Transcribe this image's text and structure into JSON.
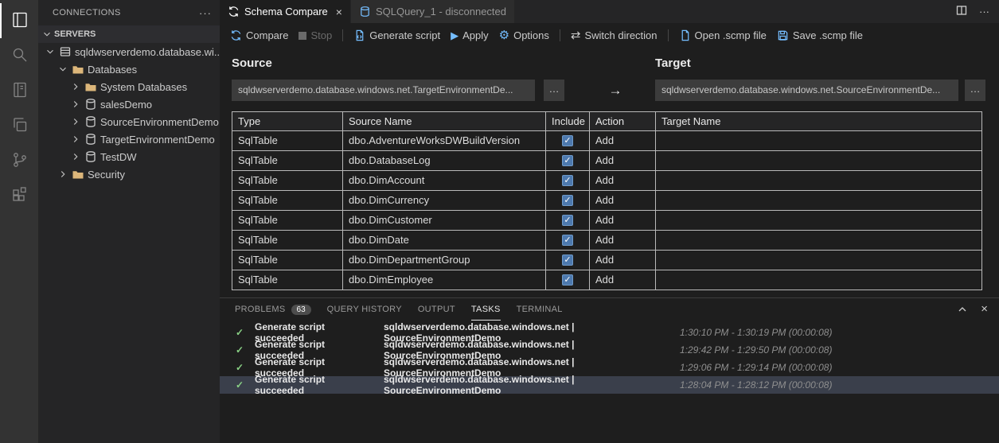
{
  "glyphs": {
    "more": "···",
    "ellipsis": "…",
    "arrow_right": "→",
    "close": "×",
    "check": "✓",
    "play": "▶",
    "gear": "⚙",
    "switch": "⇄"
  },
  "activity_bar": {
    "icons": [
      "connections-icon",
      "search-icon",
      "notebooks-icon",
      "copy-icon",
      "source-control-icon",
      "extensions-icon"
    ]
  },
  "sidebar": {
    "title": "CONNECTIONS",
    "section": "SERVERS",
    "tree": [
      {
        "label": "sqldwserverdemo.database.wi...",
        "icon": "server",
        "expanded": true
      },
      {
        "label": "Databases",
        "icon": "folder",
        "expanded": true
      },
      {
        "label": "System Databases",
        "icon": "folder",
        "expanded": false
      },
      {
        "label": "salesDemo",
        "icon": "database",
        "expanded": false
      },
      {
        "label": "SourceEnvironmentDemo",
        "icon": "database",
        "expanded": false
      },
      {
        "label": "TargetEnvironmentDemo",
        "icon": "database",
        "expanded": false
      },
      {
        "label": "TestDW",
        "icon": "database",
        "expanded": false
      },
      {
        "label": "Security",
        "icon": "folder",
        "expanded": false
      }
    ]
  },
  "editor_tabs": [
    {
      "label": "Schema Compare",
      "active": true
    },
    {
      "label": "SQLQuery_1 - disconnected",
      "active": false
    }
  ],
  "toolbar": {
    "buttons": [
      {
        "label": "Compare",
        "disabled": false
      },
      {
        "label": "Stop",
        "disabled": true
      },
      {
        "label": "Generate script",
        "disabled": false
      },
      {
        "label": "Apply",
        "disabled": false
      },
      {
        "label": "Options",
        "disabled": false
      },
      {
        "label": "Switch direction",
        "disabled": false
      },
      {
        "label": "Open .scmp file",
        "disabled": false
      },
      {
        "label": "Save .scmp file",
        "disabled": false
      }
    ]
  },
  "compare": {
    "source_label": "Source",
    "target_label": "Target",
    "source_value": "sqldwserverdemo.database.windows.net.TargetEnvironmentDe...",
    "target_value": "sqldwserverdemo.database.windows.net.SourceEnvironmentDe..."
  },
  "table": {
    "columns": [
      "Type",
      "Source Name",
      "Include",
      "Action",
      "Target Name"
    ],
    "rows": [
      {
        "type": "SqlTable",
        "source_name": "dbo.AdventureWorksDWBuildVersion",
        "include": true,
        "action": "Add",
        "target_name": ""
      },
      {
        "type": "SqlTable",
        "source_name": "dbo.DatabaseLog",
        "include": true,
        "action": "Add",
        "target_name": ""
      },
      {
        "type": "SqlTable",
        "source_name": "dbo.DimAccount",
        "include": true,
        "action": "Add",
        "target_name": ""
      },
      {
        "type": "SqlTable",
        "source_name": "dbo.DimCurrency",
        "include": true,
        "action": "Add",
        "target_name": ""
      },
      {
        "type": "SqlTable",
        "source_name": "dbo.DimCustomer",
        "include": true,
        "action": "Add",
        "target_name": ""
      },
      {
        "type": "SqlTable",
        "source_name": "dbo.DimDate",
        "include": true,
        "action": "Add",
        "target_name": ""
      },
      {
        "type": "SqlTable",
        "source_name": "dbo.DimDepartmentGroup",
        "include": true,
        "action": "Add",
        "target_name": ""
      },
      {
        "type": "SqlTable",
        "source_name": "dbo.DimEmployee",
        "include": true,
        "action": "Add",
        "target_name": ""
      }
    ]
  },
  "panel": {
    "tabs": [
      {
        "label": "PROBLEMS",
        "badge": "63",
        "active": false
      },
      {
        "label": "QUERY HISTORY",
        "active": false
      },
      {
        "label": "OUTPUT",
        "active": false
      },
      {
        "label": "TASKS",
        "active": true
      },
      {
        "label": "TERMINAL",
        "active": false
      }
    ],
    "tasks": [
      {
        "status": "Generate script succeeded",
        "detail": "sqldwserverdemo.database.windows.net | SourceEnvironmentDemo",
        "time": "1:30:10 PM - 1:30:19 PM (00:00:08)",
        "selected": false
      },
      {
        "status": "Generate script succeeded",
        "detail": "sqldwserverdemo.database.windows.net | SourceEnvironmentDemo",
        "time": "1:29:42 PM - 1:29:50 PM (00:00:08)",
        "selected": false
      },
      {
        "status": "Generate script succeeded",
        "detail": "sqldwserverdemo.database.windows.net | SourceEnvironmentDemo",
        "time": "1:29:06 PM - 1:29:14 PM (00:00:08)",
        "selected": false
      },
      {
        "status": "Generate script succeeded",
        "detail": "sqldwserverdemo.database.windows.net | SourceEnvironmentDemo",
        "time": "1:28:04 PM - 1:28:12 PM (00:00:08)",
        "selected": true
      }
    ]
  }
}
